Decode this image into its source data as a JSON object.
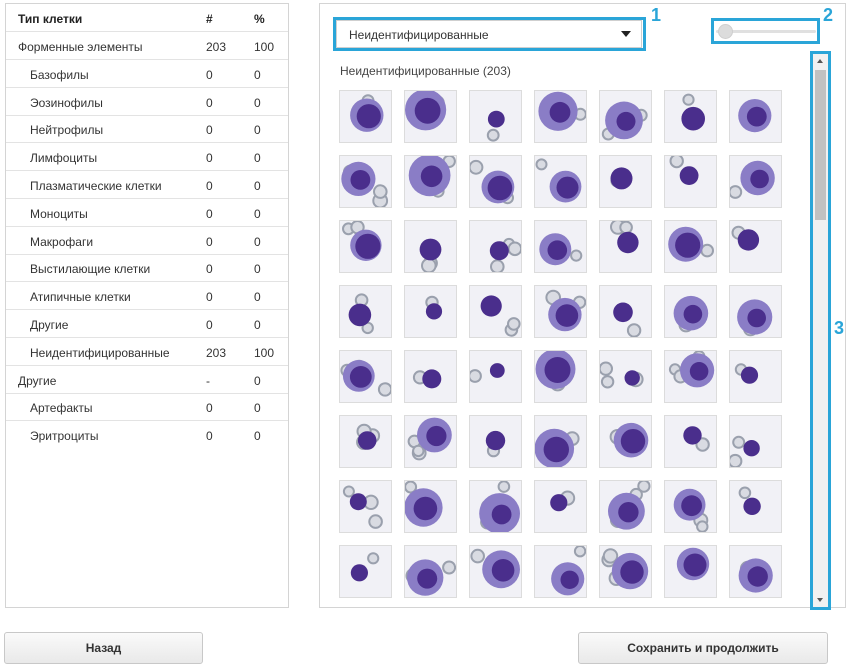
{
  "table": {
    "headers": {
      "name": "Тип клетки",
      "count": "#",
      "percent": "%"
    },
    "rows": [
      {
        "name": "Форменные элементы",
        "count": "203",
        "percent": "100",
        "level": 0
      },
      {
        "name": "Базофилы",
        "count": "0",
        "percent": "0",
        "level": 1
      },
      {
        "name": "Эозинофилы",
        "count": "0",
        "percent": "0",
        "level": 1
      },
      {
        "name": "Нейтрофилы",
        "count": "0",
        "percent": "0",
        "level": 1
      },
      {
        "name": "Лимфоциты",
        "count": "0",
        "percent": "0",
        "level": 1
      },
      {
        "name": "Плазматические клетки",
        "count": "0",
        "percent": "0",
        "level": 1
      },
      {
        "name": "Моноциты",
        "count": "0",
        "percent": "0",
        "level": 1
      },
      {
        "name": "Макрофаги",
        "count": "0",
        "percent": "0",
        "level": 1
      },
      {
        "name": "Выстилающие клетки",
        "count": "0",
        "percent": "0",
        "level": 1
      },
      {
        "name": "Атипичные клетки",
        "count": "0",
        "percent": "0",
        "level": 1
      },
      {
        "name": "Другие",
        "count": "0",
        "percent": "0",
        "level": 1
      },
      {
        "name": "Неидентифицированные",
        "count": "203",
        "percent": "100",
        "level": 1
      },
      {
        "name": "Другие",
        "count": "-",
        "percent": "0",
        "level": 0
      },
      {
        "name": "Артефакты",
        "count": "0",
        "percent": "0",
        "level": 1
      },
      {
        "name": "Эритроциты",
        "count": "0",
        "percent": "0",
        "level": 1
      }
    ]
  },
  "filter": {
    "selected": "Неидентифицированные"
  },
  "zoom_slider": {
    "value": 0.0
  },
  "gallery": {
    "title": "Неидентифицированные (203)",
    "visible_rows": 8,
    "columns": 7
  },
  "scrollbar": {
    "position": 0.0
  },
  "annotations": [
    "1",
    "2",
    "3"
  ],
  "buttons": {
    "back": "Назад",
    "save": "Сохранить и продолжить"
  },
  "colors": {
    "annotation": "#2aa5d8",
    "nucleus": "#4a2e8c",
    "cytoplasm": "#8a7dc6",
    "rbc": "#9aa0ad"
  }
}
